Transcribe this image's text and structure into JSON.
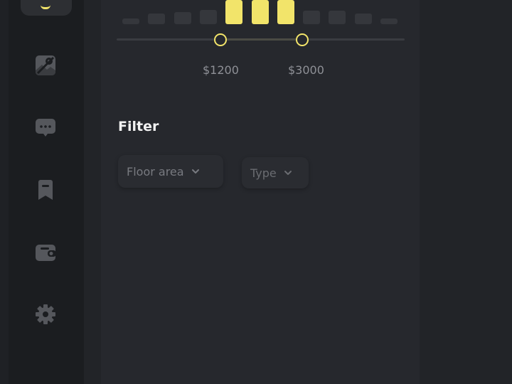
{
  "sidebar": {
    "items": [
      {
        "icon": "image-marker-icon"
      },
      {
        "icon": "chat-bubble-icon"
      },
      {
        "icon": "bookmark-icon"
      },
      {
        "icon": "wallet-icon"
      },
      {
        "icon": "gear-icon"
      }
    ]
  },
  "price_range": {
    "min_label": "$1200",
    "max_label": "$3000",
    "histogram": [
      0.15,
      0.45,
      0.5,
      0.6,
      1.0,
      1.0,
      1.0,
      0.55,
      0.55,
      0.45,
      0.15
    ],
    "selected": [
      false,
      false,
      false,
      false,
      true,
      true,
      true,
      false,
      false,
      false,
      false
    ]
  },
  "filter": {
    "title": "Filter",
    "dropdowns": [
      {
        "label": "Floor area"
      },
      {
        "label": "Type"
      }
    ]
  },
  "colors": {
    "accent": "#f2e46a",
    "bar_inactive": "#35373c",
    "sidebar_bg": "#1b1d20",
    "panel_bg": "#26282d"
  }
}
